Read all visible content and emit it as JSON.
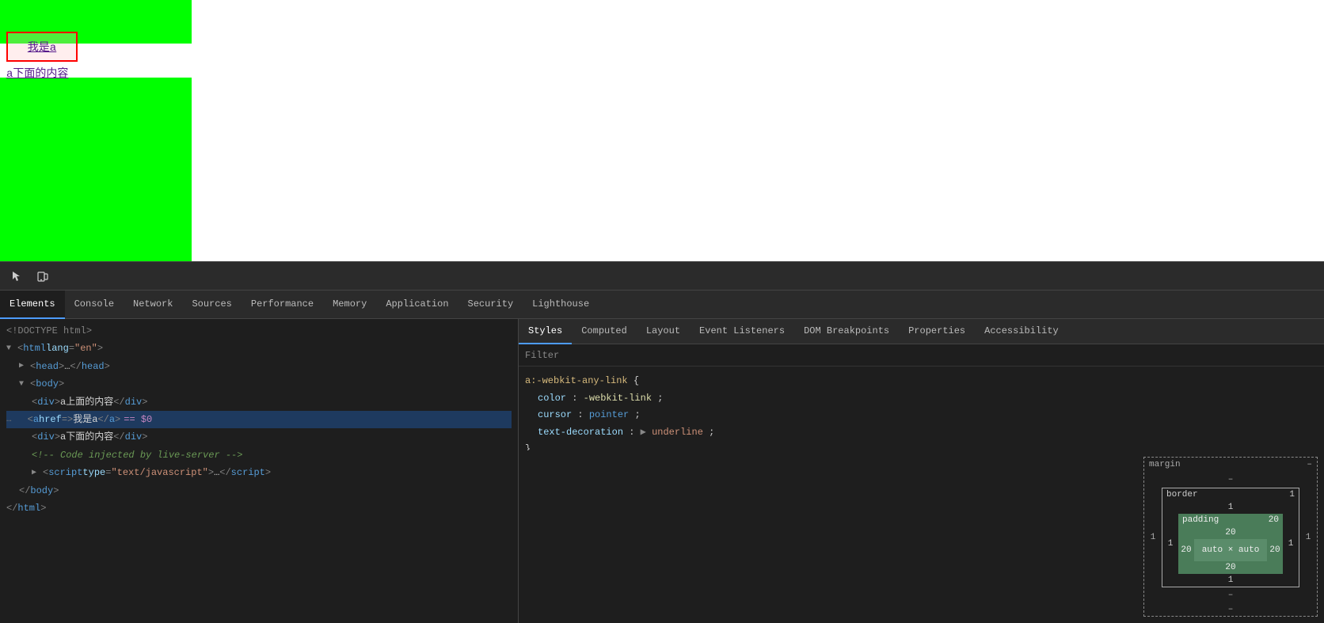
{
  "preview": {
    "link_text": "我是a",
    "text_below": "a下面的内容"
  },
  "devtools": {
    "toolbar_icons": [
      {
        "name": "cursor-icon",
        "symbol": "↖"
      },
      {
        "name": "device-icon",
        "symbol": "⬜"
      }
    ],
    "tabs": [
      {
        "label": "Elements",
        "active": true
      },
      {
        "label": "Console",
        "active": false
      },
      {
        "label": "Network",
        "active": false
      },
      {
        "label": "Sources",
        "active": false
      },
      {
        "label": "Performance",
        "active": false
      },
      {
        "label": "Memory",
        "active": false
      },
      {
        "label": "Application",
        "active": false
      },
      {
        "label": "Security",
        "active": false
      },
      {
        "label": "Lighthouse",
        "active": false
      }
    ]
  },
  "dom": {
    "lines": [
      {
        "indent": 0,
        "content": "doctype",
        "text": "<!DOCTYPE html>"
      },
      {
        "indent": 0,
        "content": "open",
        "tag": "html",
        "attrs": [
          {
            "name": "lang",
            "value": "\"en\""
          }
        ]
      },
      {
        "indent": 1,
        "content": "collapsed",
        "tag": "head",
        "collapsed": true
      },
      {
        "indent": 1,
        "content": "open-tag",
        "tag": "body"
      },
      {
        "indent": 2,
        "content": "element",
        "tag": "div",
        "inner": "a上面的内容"
      },
      {
        "indent": 2,
        "content": "selected",
        "tag": "a",
        "attrs": [
          {
            "name": "href",
            "value": ""
          }
        ],
        "inner": "我是a",
        "selected": true
      },
      {
        "indent": 2,
        "content": "element",
        "tag": "div",
        "inner": "a下面的内容"
      },
      {
        "indent": 2,
        "content": "comment",
        "text": "<!-- Code injected by live-server -->"
      },
      {
        "indent": 2,
        "content": "collapsed",
        "tag": "script",
        "attrs": [
          {
            "name": "type",
            "value": "\"text/javascript\""
          }
        ]
      },
      {
        "indent": 1,
        "content": "close-tag",
        "tag": "body"
      },
      {
        "indent": 0,
        "content": "close-tag",
        "tag": "html"
      }
    ]
  },
  "styles": {
    "sub_tabs": [
      {
        "label": "Styles",
        "active": true
      },
      {
        "label": "Computed",
        "active": false
      },
      {
        "label": "Layout",
        "active": false
      },
      {
        "label": "Event Listeners",
        "active": false
      },
      {
        "label": "DOM Breakpoints",
        "active": false
      },
      {
        "label": "Properties",
        "active": false
      },
      {
        "label": "Accessibility",
        "active": false
      }
    ],
    "filter_placeholder": "Filter",
    "rule": {
      "selector": "a:-webkit-any-link",
      "properties": [
        {
          "name": "color",
          "value": "-webkit-link",
          "type": "func"
        },
        {
          "name": "cursor",
          "value": "pointer",
          "type": "keyword"
        },
        {
          "name": "text-decoration",
          "arrow": true,
          "value": "underline",
          "type": "normal"
        }
      ]
    }
  },
  "box_model": {
    "outer_label": "margin",
    "outer_dash": "–",
    "margin_top": "–",
    "margin_right": "1",
    "margin_bottom": "–",
    "margin_left": "1",
    "border_label": "border",
    "border_val": "1",
    "border_top": "1",
    "border_right": "1",
    "border_bottom": "1",
    "border_left": "1",
    "padding_label": "padding",
    "padding_val": "20",
    "padding_top": "20",
    "padding_right": "20",
    "padding_bottom": "20",
    "padding_left": "20",
    "content": "auto × auto",
    "minus_bottom": "–"
  }
}
